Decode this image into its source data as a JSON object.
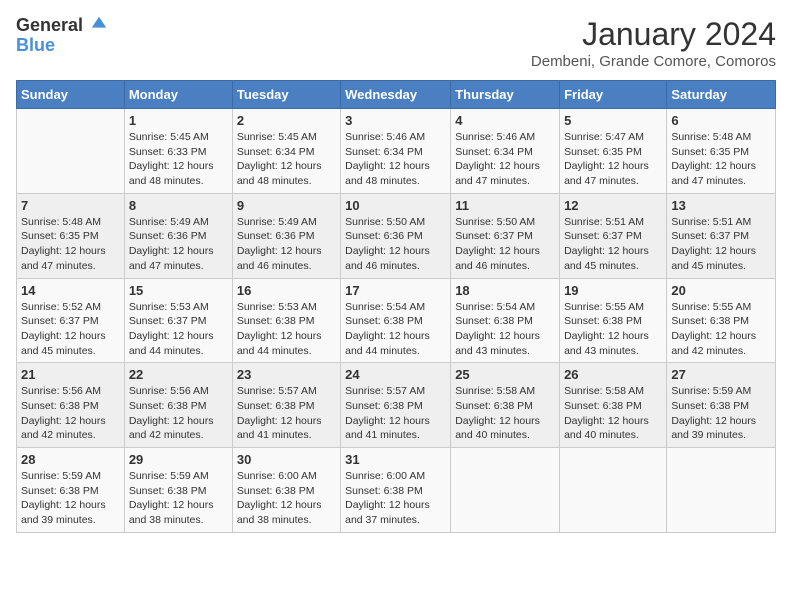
{
  "logo": {
    "line1": "General",
    "line2": "Blue"
  },
  "title": "January 2024",
  "location": "Dembeni, Grande Comore, Comoros",
  "weekdays": [
    "Sunday",
    "Monday",
    "Tuesday",
    "Wednesday",
    "Thursday",
    "Friday",
    "Saturday"
  ],
  "weeks": [
    [
      {
        "day": "",
        "sunrise": "",
        "sunset": "",
        "daylight": ""
      },
      {
        "day": "1",
        "sunrise": "Sunrise: 5:45 AM",
        "sunset": "Sunset: 6:33 PM",
        "daylight": "Daylight: 12 hours and 48 minutes."
      },
      {
        "day": "2",
        "sunrise": "Sunrise: 5:45 AM",
        "sunset": "Sunset: 6:34 PM",
        "daylight": "Daylight: 12 hours and 48 minutes."
      },
      {
        "day": "3",
        "sunrise": "Sunrise: 5:46 AM",
        "sunset": "Sunset: 6:34 PM",
        "daylight": "Daylight: 12 hours and 48 minutes."
      },
      {
        "day": "4",
        "sunrise": "Sunrise: 5:46 AM",
        "sunset": "Sunset: 6:34 PM",
        "daylight": "Daylight: 12 hours and 47 minutes."
      },
      {
        "day": "5",
        "sunrise": "Sunrise: 5:47 AM",
        "sunset": "Sunset: 6:35 PM",
        "daylight": "Daylight: 12 hours and 47 minutes."
      },
      {
        "day": "6",
        "sunrise": "Sunrise: 5:48 AM",
        "sunset": "Sunset: 6:35 PM",
        "daylight": "Daylight: 12 hours and 47 minutes."
      }
    ],
    [
      {
        "day": "7",
        "sunrise": "Sunrise: 5:48 AM",
        "sunset": "Sunset: 6:35 PM",
        "daylight": "Daylight: 12 hours and 47 minutes."
      },
      {
        "day": "8",
        "sunrise": "Sunrise: 5:49 AM",
        "sunset": "Sunset: 6:36 PM",
        "daylight": "Daylight: 12 hours and 47 minutes."
      },
      {
        "day": "9",
        "sunrise": "Sunrise: 5:49 AM",
        "sunset": "Sunset: 6:36 PM",
        "daylight": "Daylight: 12 hours and 46 minutes."
      },
      {
        "day": "10",
        "sunrise": "Sunrise: 5:50 AM",
        "sunset": "Sunset: 6:36 PM",
        "daylight": "Daylight: 12 hours and 46 minutes."
      },
      {
        "day": "11",
        "sunrise": "Sunrise: 5:50 AM",
        "sunset": "Sunset: 6:37 PM",
        "daylight": "Daylight: 12 hours and 46 minutes."
      },
      {
        "day": "12",
        "sunrise": "Sunrise: 5:51 AM",
        "sunset": "Sunset: 6:37 PM",
        "daylight": "Daylight: 12 hours and 45 minutes."
      },
      {
        "day": "13",
        "sunrise": "Sunrise: 5:51 AM",
        "sunset": "Sunset: 6:37 PM",
        "daylight": "Daylight: 12 hours and 45 minutes."
      }
    ],
    [
      {
        "day": "14",
        "sunrise": "Sunrise: 5:52 AM",
        "sunset": "Sunset: 6:37 PM",
        "daylight": "Daylight: 12 hours and 45 minutes."
      },
      {
        "day": "15",
        "sunrise": "Sunrise: 5:53 AM",
        "sunset": "Sunset: 6:37 PM",
        "daylight": "Daylight: 12 hours and 44 minutes."
      },
      {
        "day": "16",
        "sunrise": "Sunrise: 5:53 AM",
        "sunset": "Sunset: 6:38 PM",
        "daylight": "Daylight: 12 hours and 44 minutes."
      },
      {
        "day": "17",
        "sunrise": "Sunrise: 5:54 AM",
        "sunset": "Sunset: 6:38 PM",
        "daylight": "Daylight: 12 hours and 44 minutes."
      },
      {
        "day": "18",
        "sunrise": "Sunrise: 5:54 AM",
        "sunset": "Sunset: 6:38 PM",
        "daylight": "Daylight: 12 hours and 43 minutes."
      },
      {
        "day": "19",
        "sunrise": "Sunrise: 5:55 AM",
        "sunset": "Sunset: 6:38 PM",
        "daylight": "Daylight: 12 hours and 43 minutes."
      },
      {
        "day": "20",
        "sunrise": "Sunrise: 5:55 AM",
        "sunset": "Sunset: 6:38 PM",
        "daylight": "Daylight: 12 hours and 42 minutes."
      }
    ],
    [
      {
        "day": "21",
        "sunrise": "Sunrise: 5:56 AM",
        "sunset": "Sunset: 6:38 PM",
        "daylight": "Daylight: 12 hours and 42 minutes."
      },
      {
        "day": "22",
        "sunrise": "Sunrise: 5:56 AM",
        "sunset": "Sunset: 6:38 PM",
        "daylight": "Daylight: 12 hours and 42 minutes."
      },
      {
        "day": "23",
        "sunrise": "Sunrise: 5:57 AM",
        "sunset": "Sunset: 6:38 PM",
        "daylight": "Daylight: 12 hours and 41 minutes."
      },
      {
        "day": "24",
        "sunrise": "Sunrise: 5:57 AM",
        "sunset": "Sunset: 6:38 PM",
        "daylight": "Daylight: 12 hours and 41 minutes."
      },
      {
        "day": "25",
        "sunrise": "Sunrise: 5:58 AM",
        "sunset": "Sunset: 6:38 PM",
        "daylight": "Daylight: 12 hours and 40 minutes."
      },
      {
        "day": "26",
        "sunrise": "Sunrise: 5:58 AM",
        "sunset": "Sunset: 6:38 PM",
        "daylight": "Daylight: 12 hours and 40 minutes."
      },
      {
        "day": "27",
        "sunrise": "Sunrise: 5:59 AM",
        "sunset": "Sunset: 6:38 PM",
        "daylight": "Daylight: 12 hours and 39 minutes."
      }
    ],
    [
      {
        "day": "28",
        "sunrise": "Sunrise: 5:59 AM",
        "sunset": "Sunset: 6:38 PM",
        "daylight": "Daylight: 12 hours and 39 minutes."
      },
      {
        "day": "29",
        "sunrise": "Sunrise: 5:59 AM",
        "sunset": "Sunset: 6:38 PM",
        "daylight": "Daylight: 12 hours and 38 minutes."
      },
      {
        "day": "30",
        "sunrise": "Sunrise: 6:00 AM",
        "sunset": "Sunset: 6:38 PM",
        "daylight": "Daylight: 12 hours and 38 minutes."
      },
      {
        "day": "31",
        "sunrise": "Sunrise: 6:00 AM",
        "sunset": "Sunset: 6:38 PM",
        "daylight": "Daylight: 12 hours and 37 minutes."
      },
      {
        "day": "",
        "sunrise": "",
        "sunset": "",
        "daylight": ""
      },
      {
        "day": "",
        "sunrise": "",
        "sunset": "",
        "daylight": ""
      },
      {
        "day": "",
        "sunrise": "",
        "sunset": "",
        "daylight": ""
      }
    ]
  ]
}
